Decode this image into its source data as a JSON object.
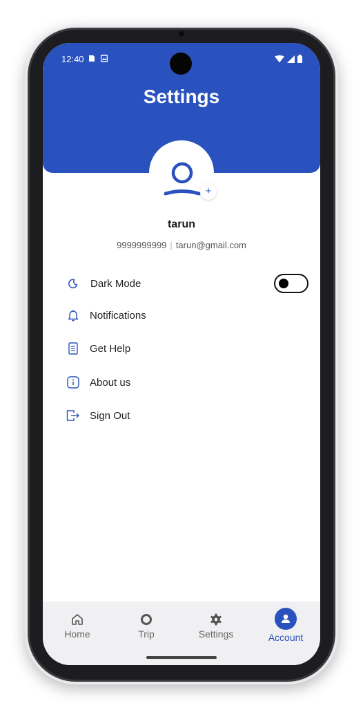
{
  "status_bar": {
    "time": "12:40"
  },
  "header": {
    "title": "Settings"
  },
  "profile": {
    "add_symbol": "+",
    "name": "tarun",
    "phone": "9999999999",
    "separator": "|",
    "email": "tarun@gmail.com"
  },
  "menu": {
    "dark_mode": {
      "label": "Dark Mode",
      "icon": "moon-icon",
      "enabled": false
    },
    "items": [
      {
        "label": "Notifications",
        "icon": "bell-icon"
      },
      {
        "label": "Get Help",
        "icon": "document-icon"
      },
      {
        "label": "About us",
        "icon": "info-icon"
      },
      {
        "label": "Sign Out",
        "icon": "logout-icon"
      }
    ]
  },
  "bottom_nav": {
    "items": [
      {
        "label": "Home",
        "icon": "home-icon"
      },
      {
        "label": "Trip",
        "icon": "circle-icon"
      },
      {
        "label": "Settings",
        "icon": "gear-icon"
      },
      {
        "label": "Account",
        "icon": "account-icon",
        "active": true
      }
    ]
  },
  "colors": {
    "primary": "#2a52be",
    "nav_background": "#f0f0f2"
  }
}
